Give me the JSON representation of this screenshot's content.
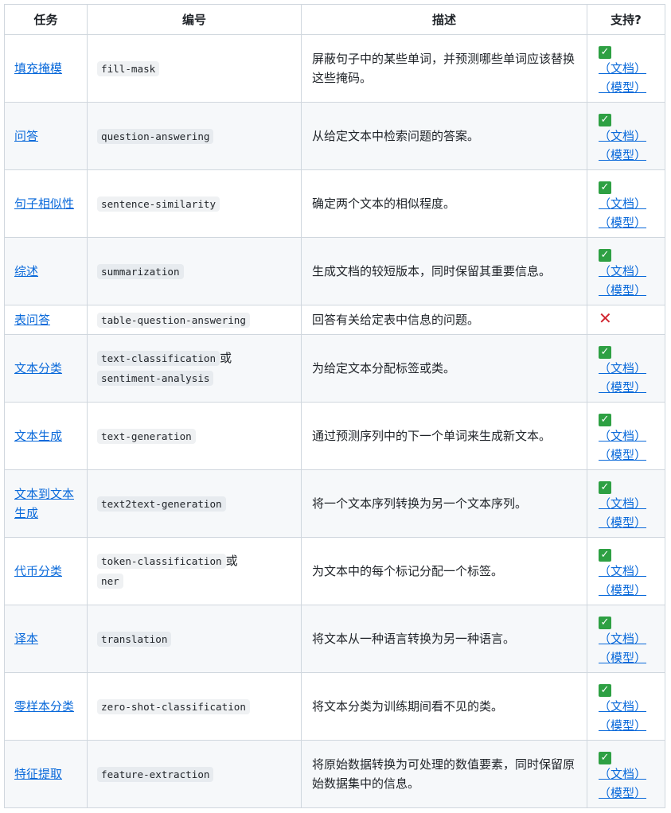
{
  "headers": [
    "任务",
    "编号",
    "描述",
    "支持?"
  ],
  "support_link_labels": {
    "doc": "（文档）",
    "model": "（模型）"
  },
  "rows": [
    {
      "task": "填充掩模",
      "ids": [
        "fill-mask"
      ],
      "desc": "屏蔽句子中的某些单词，并预测哪些单词应该替换这些掩码。",
      "supported": true
    },
    {
      "task": "问答",
      "ids": [
        "question-answering"
      ],
      "desc": "从给定文本中检索问题的答案。",
      "supported": true
    },
    {
      "task": "句子相似性",
      "ids": [
        "sentence-similarity"
      ],
      "desc": "确定两个文本的相似程度。",
      "supported": true
    },
    {
      "task": "综述",
      "ids": [
        "summarization"
      ],
      "desc": "生成文档的较短版本，同时保留其重要信息。",
      "supported": true
    },
    {
      "task": "表问答",
      "ids": [
        "table-question-answering"
      ],
      "desc": "回答有关给定表中信息的问题。",
      "supported": false
    },
    {
      "task": "文本分类",
      "ids": [
        "text-classification",
        "sentiment-analysis"
      ],
      "joiner": "或",
      "desc": "为给定文本分配标签或类。",
      "supported": true
    },
    {
      "task": "文本生成",
      "ids": [
        "text-generation"
      ],
      "desc": "通过预测序列中的下一个单词来生成新文本。",
      "supported": true
    },
    {
      "task": "文本到文本生成",
      "ids": [
        "text2text-generation"
      ],
      "desc": "将一个文本序列转换为另一个文本序列。",
      "supported": true
    },
    {
      "task": "代币分类",
      "ids": [
        "token-classification",
        "ner"
      ],
      "joiner": "或",
      "desc": "为文本中的每个标记分配一个标签。",
      "supported": true
    },
    {
      "task": "译本",
      "ids": [
        "translation"
      ],
      "desc": "将文本从一种语言转换为另一种语言。",
      "supported": true
    },
    {
      "task": "零样本分类",
      "ids": [
        "zero-shot-classification"
      ],
      "desc": "将文本分类为训练期间看不见的类。",
      "supported": true
    },
    {
      "task": "特征提取",
      "ids": [
        "feature-extraction"
      ],
      "desc": "将原始数据转换为可处理的数值要素，同时保留原始数据集中的信息。",
      "supported": true
    }
  ]
}
